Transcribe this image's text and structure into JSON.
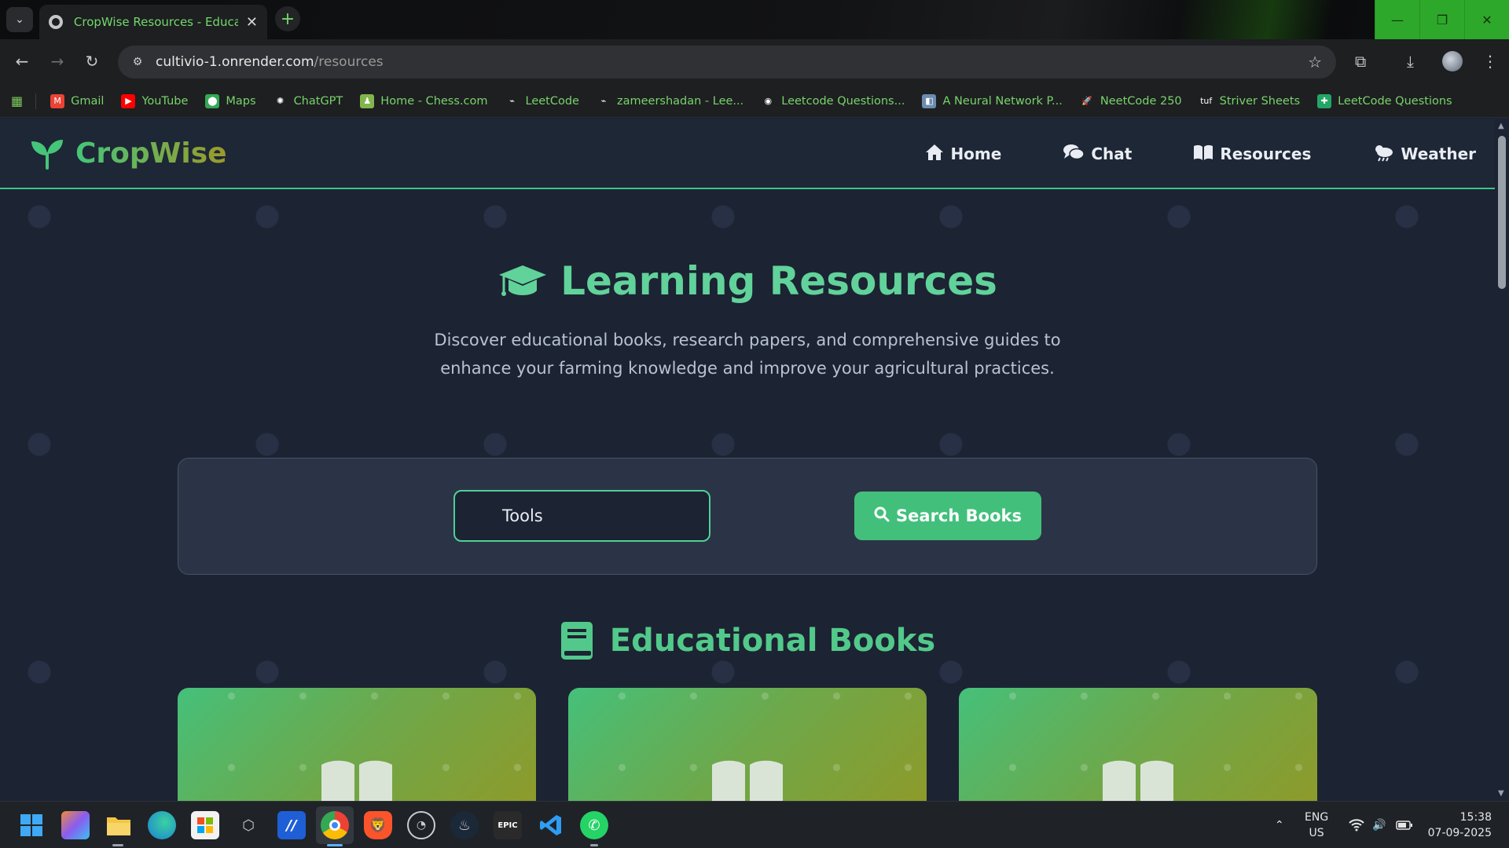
{
  "browser": {
    "tab_title": "CropWise Resources - Educatio",
    "url_host": "cultivio-1.onrender.com",
    "url_path": "/resources",
    "bookmarks": [
      {
        "label": "Gmail",
        "color": "#ea4335",
        "glyph": "M"
      },
      {
        "label": "YouTube",
        "color": "#ff0000",
        "glyph": "▶"
      },
      {
        "label": "Maps",
        "color": "#34a853",
        "glyph": "⬤"
      },
      {
        "label": "ChatGPT",
        "color": "#1d1f21",
        "glyph": "✺"
      },
      {
        "label": "Home - Chess.com",
        "color": "#81b64c",
        "glyph": "♟"
      },
      {
        "label": "LeetCode",
        "color": "#1d1f21",
        "glyph": "⌁"
      },
      {
        "label": "zameershadan - Lee...",
        "color": "#1d1f21",
        "glyph": "⌁"
      },
      {
        "label": "Leetcode Questions...",
        "color": "#1d1f21",
        "glyph": "◉"
      },
      {
        "label": "A Neural Network P...",
        "color": "#6b8cae",
        "glyph": "◧"
      },
      {
        "label": "NeetCode 250",
        "color": "#1d1f21",
        "glyph": "🚀"
      },
      {
        "label": "Striver Sheets",
        "color": "#1d1f21",
        "glyph": "tuf"
      },
      {
        "label": "LeetCode Questions",
        "color": "#23a566",
        "glyph": "✚"
      }
    ]
  },
  "site": {
    "brand": "CropWise",
    "nav": [
      {
        "label": "Home",
        "icon": "home-icon",
        "glyph": "🏠"
      },
      {
        "label": "Chat",
        "icon": "chat-icon",
        "glyph": "💬"
      },
      {
        "label": "Resources",
        "icon": "book-open-icon",
        "glyph": "📖"
      },
      {
        "label": "Weather",
        "icon": "cloud-sun-rain-icon",
        "glyph": "⛅"
      }
    ],
    "hero_title": "Learning Resources",
    "hero_subtitle_line1": "Discover educational books, research papers, and comprehensive guides to",
    "hero_subtitle_line2": "enhance your farming knowledge and improve your agricultural practices.",
    "search_value": "Tools",
    "search_button": "Search Books",
    "section_title": "Educational Books",
    "accent": "#42c07b"
  },
  "taskbar": {
    "lang_top": "ENG",
    "lang_bottom": "US",
    "time": "15:38",
    "date": "07-09-2025"
  }
}
